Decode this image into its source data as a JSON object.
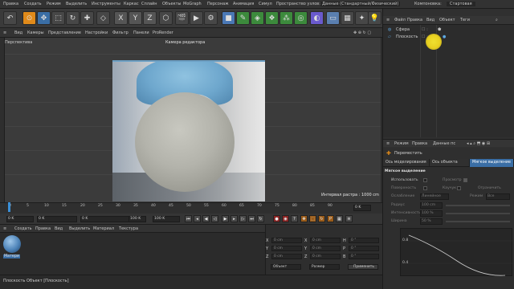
{
  "menubar": {
    "items": [
      "Правка",
      "Создать",
      "Режим",
      "Выделить",
      "Инструменты",
      "Каркас",
      "Сплайн",
      "Объекты",
      "MoGraph",
      "Персонаж",
      "Анимация",
      "Симул"
    ],
    "space_label": "Пространство узлов:",
    "space_value": "Данные (Стандартный/Физический)",
    "layout_label": "Компоновка:",
    "layout_value": "Стартовая"
  },
  "toolbar": {
    "axis_x": "X",
    "axis_y": "Y",
    "axis_z": "Z"
  },
  "viewport_menu": [
    "Вид",
    "Камеры",
    "Представление",
    "Настройки",
    "Фильтр",
    "Панели",
    "ProRender"
  ],
  "viewport": {
    "name": "Перспектива",
    "camera": "Камера редактора",
    "raster": "Интервал растра : 1000 cm"
  },
  "timeline": {
    "ticks": [
      "0",
      "5",
      "10",
      "15",
      "20",
      "25",
      "30",
      "35",
      "40",
      "45",
      "50",
      "55",
      "60",
      "65",
      "70",
      "75",
      "80",
      "85",
      "90"
    ],
    "current_frame": "0 K",
    "frame_field": "0 K",
    "start": "0 K",
    "start2": "0 K",
    "end": "100 K",
    "end2": "100 K"
  },
  "material_menu": [
    "Создать",
    "Правка",
    "Вид",
    "Выделить",
    "Материал",
    "Текстура"
  ],
  "material": {
    "name": "Матери"
  },
  "coords": {
    "rows": [
      {
        "axis": "X",
        "value": "0 cm",
        "axis2": "X",
        "value2": "0 cm",
        "axis3": "H",
        "value3": "0 °"
      },
      {
        "axis": "Y",
        "value": "0 cm",
        "axis2": "Y",
        "value2": "0 cm",
        "axis3": "P",
        "value3": "0 °"
      },
      {
        "axis": "Z",
        "value": "0 cm",
        "axis2": "Z",
        "value2": "0 cm",
        "axis3": "B",
        "value3": "0 °"
      }
    ],
    "mode": "Объект",
    "size": "Размер",
    "apply": "Применить"
  },
  "status": "Плоскость Объект [Плоскость]",
  "objects_menu": [
    "Файл",
    "Правка",
    "Вид",
    "Объект",
    "Теги"
  ],
  "objects": [
    {
      "name": "Сфера"
    },
    {
      "name": "Плоскость"
    }
  ],
  "attr_menu": [
    "Режим",
    "Правка",
    "Данные пс"
  ],
  "attr": {
    "tool": "Переместить",
    "tabs": [
      "Ось моделирования",
      "Ось объекта",
      "Мягкое выделение"
    ],
    "section": "Мягкое выделение",
    "rows": [
      {
        "label": "Использовать",
        "right": "Просмотр"
      },
      {
        "label": "Поверхность",
        "right": "Каучук",
        "right2": "Ограничить"
      },
      {
        "label": "Ослабление",
        "value": "Линейное",
        "right": "Режим",
        "right_value": "Все"
      },
      {
        "label": "Радиус",
        "value": "100 cm"
      },
      {
        "label": "Интенсивность",
        "value": "100 %"
      },
      {
        "label": "Ширина",
        "value": "50 %"
      }
    ],
    "graph_y1": "0.8",
    "graph_y2": "0.4"
  }
}
